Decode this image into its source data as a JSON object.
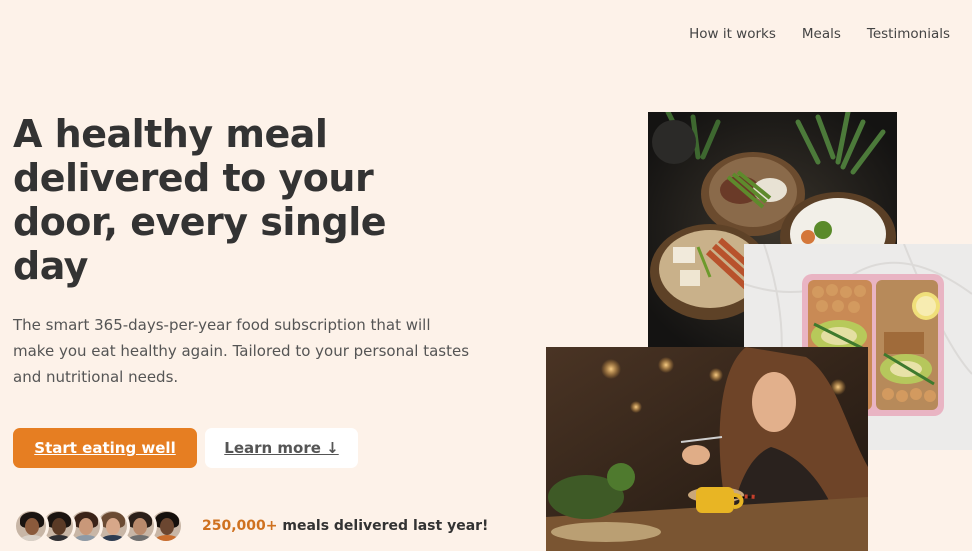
{
  "nav": {
    "items": [
      {
        "label": "How it works"
      },
      {
        "label": "Meals"
      },
      {
        "label": "Testimonials"
      }
    ]
  },
  "hero": {
    "title": "A healthy meal delivered to your door, every single day",
    "description": "The smart 365-days-per-year food subscription that will make you eat healthy again. Tailored to your personal tastes and nutritional needs.",
    "primary_button": "Start eating well",
    "secondary_button": "Learn more ↓"
  },
  "delivered": {
    "count": "250,000+",
    "text": " meals delivered last year!"
  },
  "colors": {
    "background": "#fdf2e9",
    "accent": "#e67e22",
    "accent_text": "#cf711f",
    "text": "#333333"
  },
  "avatars": [
    {
      "skin": "#8a5a3c",
      "hair": "#1a1411",
      "shirt": "#d9d1c8"
    },
    {
      "skin": "#5a3a26",
      "hair": "#1b1410",
      "shirt": "#2f2f33"
    },
    {
      "skin": "#c99879",
      "hair": "#3a2318",
      "shirt": "#8e9aa6"
    },
    {
      "skin": "#d7a789",
      "hair": "#6b4b33",
      "shirt": "#2d3c52"
    },
    {
      "skin": "#b98a6c",
      "hair": "#2a1f19",
      "shirt": "#6f6f6f"
    },
    {
      "skin": "#6b4630",
      "hair": "#15100d",
      "shirt": "#c96d2e"
    }
  ]
}
